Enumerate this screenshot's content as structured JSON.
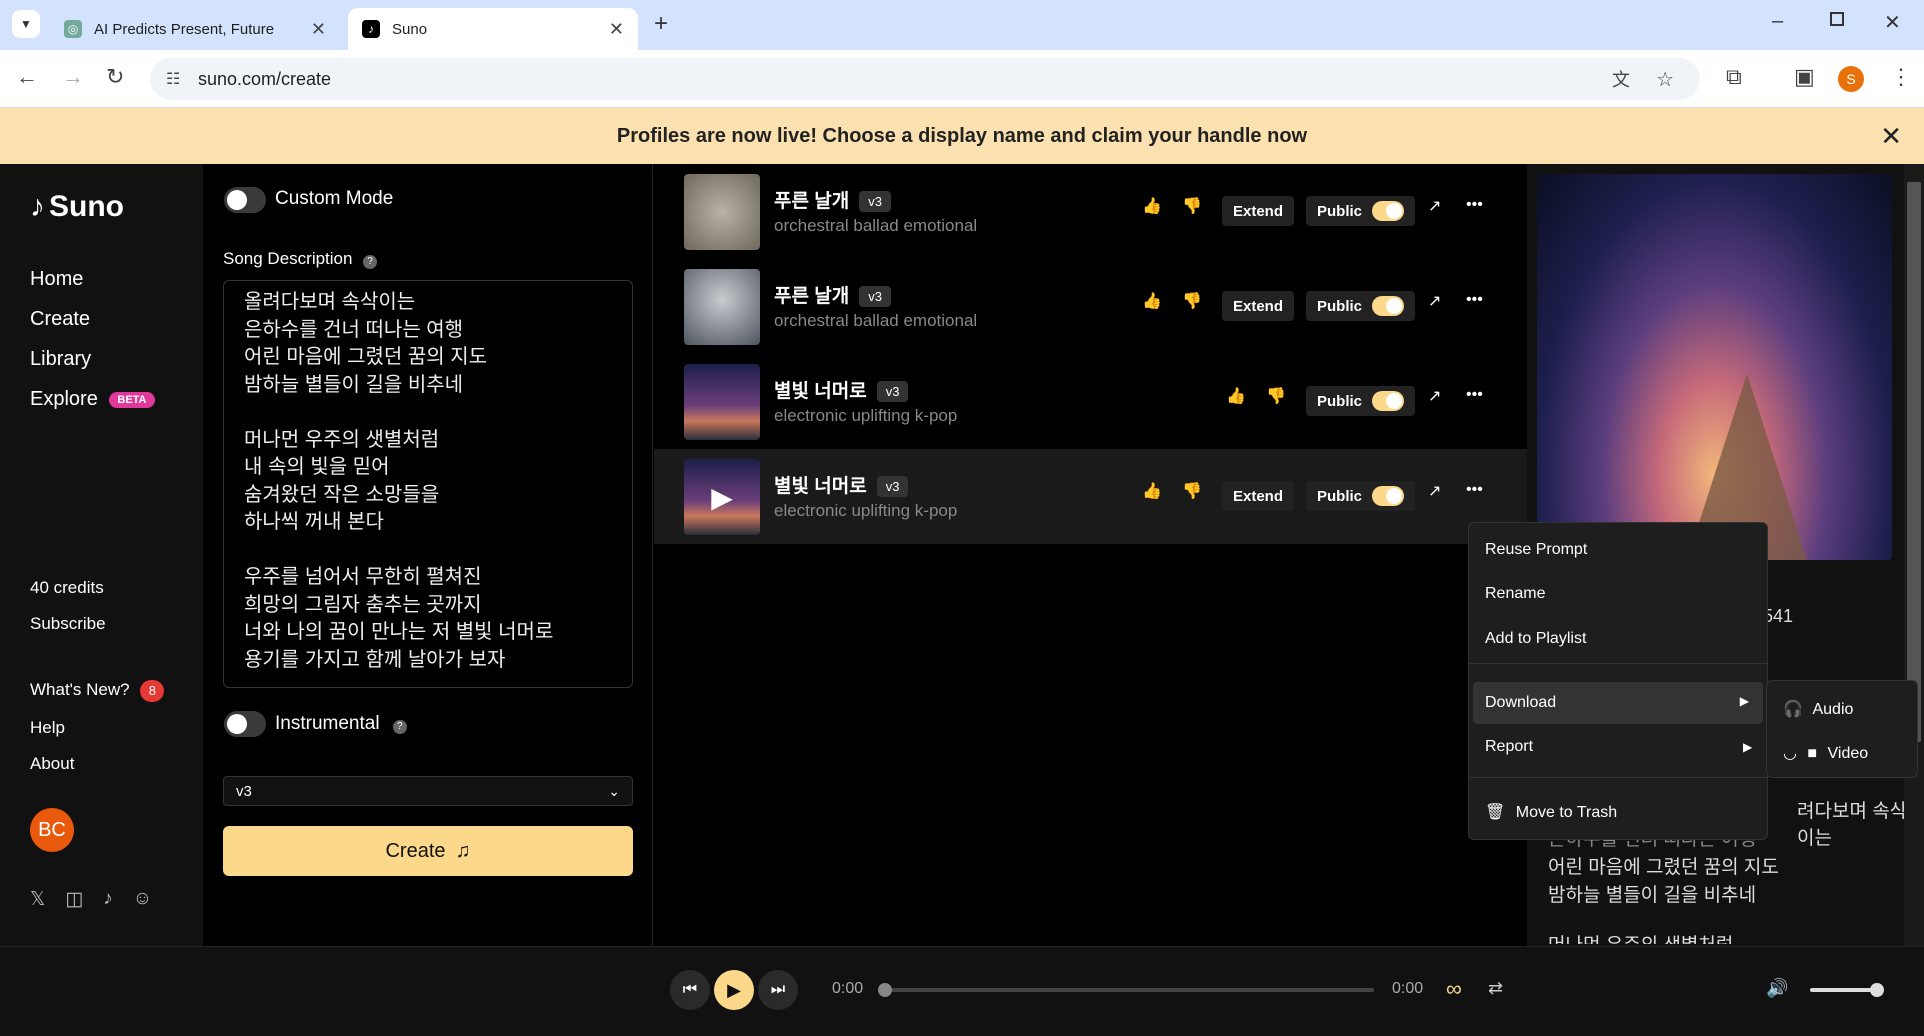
{
  "browser": {
    "tabs": [
      {
        "title": "AI Predicts Present, Future"
      },
      {
        "title": "Suno"
      }
    ],
    "url": "suno.com/create",
    "profile_initial": "S"
  },
  "banner": {
    "text": "Profiles are now live! Choose a display name and claim your handle now"
  },
  "sidebar": {
    "logo": "Suno",
    "nav": [
      {
        "label": "Home"
      },
      {
        "label": "Create"
      },
      {
        "label": "Library"
      },
      {
        "label": "Explore",
        "badge": "BETA"
      }
    ],
    "credits": "40 credits",
    "subscribe": "Subscribe",
    "whats_new": "What's New?",
    "whats_new_count": "8",
    "help": "Help",
    "about": "About",
    "avatar": "BC"
  },
  "form": {
    "custom_mode": "Custom Mode",
    "song_description_label": "Song Description",
    "lyrics": "올려다보며 속삭이는\n은하수를 건너 떠나는 여행\n어린 마음에 그렸던 꿈의 지도\n밤하늘 별들이 길을 비추네\n\n머나먼 우주의 샛별처럼\n내 속의 빛을 믿어\n숨겨왔던 작은 소망들을\n하나씩 꺼내 본다\n\n우주를 넘어서 무한히 펼쳐진\n희망의 그림자 춤추는 곳까지\n너와 나의 꿈이 만나는 저 별빛 너머로\n용기를 가지고 함께 날아가 보자",
    "instrumental": "Instrumental",
    "model": "v3",
    "create_button": "Create"
  },
  "songs": [
    {
      "title": "푸른 날개",
      "version": "v3",
      "tags": "orchestral ballad emotional",
      "extend": "Extend",
      "public": "Public"
    },
    {
      "title": "푸른 날개",
      "version": "v3",
      "tags": "orchestral ballad emotional",
      "extend": "Extend",
      "public": "Public"
    },
    {
      "title": "별빛 너머로",
      "version": "v3",
      "tags": "electronic uplifting k-pop",
      "public": "Public"
    },
    {
      "title": "별빛 너머로",
      "version": "v3",
      "tags": "electronic uplifting k-pop",
      "extend": "Extend",
      "public": "Public"
    }
  ],
  "context_menu": {
    "items": [
      "Reuse Prompt",
      "Rename",
      "Add to Playlist",
      "Download",
      "Report",
      "Move to Trash"
    ],
    "download_submenu": [
      "Audio",
      "Video"
    ]
  },
  "right_panel": {
    "partial_number": "541",
    "lyrics_preview": [
      "려다보며 속삭이는",
      "은하수를 건너 떠나는 여행",
      "어린 마음에 그렸던 꿈의 지도",
      "밤하늘 별들이 길을 비추네",
      "머나먼 우주의 샛별처럼"
    ]
  },
  "player": {
    "time_current": "0:00",
    "time_total": "0:00",
    "progress": 0,
    "volume": 0.9
  }
}
